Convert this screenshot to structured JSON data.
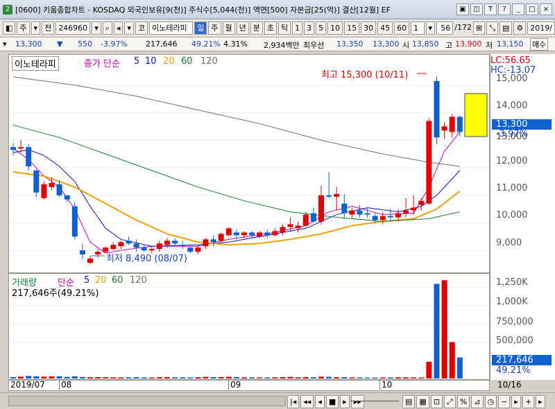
{
  "window": {
    "app_icon": "2",
    "title": "[0600] 키움종합차트 - KOSDAQ 외국인보유[9(천)] 주식수[5,044(천)] 액면[500] 자본금[25(억)] 결산[12월] EF",
    "controls": [
      "▣",
      "◫",
      "T",
      "?",
      "_",
      "□",
      "×"
    ]
  },
  "toolbar": {
    "market": "주",
    "prefix": "전",
    "code": "246960",
    "kind": "코",
    "name": "이노테라피",
    "periods": [
      "일",
      "주",
      "월",
      "년",
      "분",
      "초",
      "틱"
    ],
    "active_period": "일",
    "intervals": [
      "1",
      "3",
      "5",
      "10",
      "15",
      "30",
      "45",
      "60"
    ],
    "interval_value": "1",
    "count": "56",
    "total": "/172",
    "date": "2019/"
  },
  "quote": {
    "price": "13,300",
    "change": "550",
    "change_pct": "-3.97%",
    "volume": "217,646",
    "volume_ratio": "49.21%",
    "turnover": "4.31%",
    "amount": "2,934백만",
    "label_best": "최우선",
    "best_ask": "13,350",
    "best_bid": "13,300",
    "open_label": "시",
    "open": "13,850",
    "high_label": "고",
    "high": "13,900",
    "low_label": "저",
    "low": "13,150",
    "order_btn": "매수"
  },
  "legend": {
    "name": "이노테라피",
    "ma_label": "종가 단순",
    "ma_periods": [
      "5",
      "10",
      "20",
      "60",
      "120"
    ],
    "ma_colors": [
      "#c000c0",
      "#1010c0",
      "#f0a000",
      "#108030",
      "#707070"
    ]
  },
  "volume_legend": {
    "name": "거래량",
    "ma_label": "단순",
    "ma_periods": [
      "5",
      "20",
      "60",
      "120"
    ],
    "current": "217,646주(49.21%)"
  },
  "annotations": {
    "high": "최고 15,300 (10/11)",
    "low": "최저 8,490 (08/07)"
  },
  "axis": {
    "lc": "LC:56.65",
    "hc": "HC:-13.07",
    "price_ticks": [
      "15,000",
      "14,000",
      "13,000",
      "12,000",
      "11,000",
      "10,000",
      "9,000"
    ],
    "current_price": "13,300",
    "current_pct": "-3.97%",
    "vol_ticks": [
      "1,250K",
      "1,000K",
      "750,000",
      "500,000"
    ],
    "current_vol": "217,646",
    "current_vol_pct": "49.21%",
    "last_date": "10/16"
  },
  "dates": [
    "2019/07",
    "08",
    "09",
    "10"
  ],
  "colors": {
    "up": "#e00000",
    "down": "#1060d0",
    "accent": "#3366cc"
  },
  "chart_data": {
    "type": "candlestick",
    "price_range": [
      8300,
      15600
    ],
    "candles": [
      {
        "o": 12750,
        "h": 12900,
        "l": 12450,
        "c": 12650
      },
      {
        "o": 12700,
        "h": 13000,
        "l": 12550,
        "c": 12750
      },
      {
        "o": 12750,
        "h": 12850,
        "l": 11900,
        "c": 12050
      },
      {
        "o": 11900,
        "h": 11950,
        "l": 10950,
        "c": 11100
      },
      {
        "o": 10900,
        "h": 11500,
        "l": 10850,
        "c": 11400
      },
      {
        "o": 11300,
        "h": 11650,
        "l": 11200,
        "c": 11450
      },
      {
        "o": 11400,
        "h": 11550,
        "l": 10950,
        "c": 11000
      },
      {
        "o": 11000,
        "h": 11000,
        "l": 10750,
        "c": 10850
      },
      {
        "o": 10600,
        "h": 10750,
        "l": 9400,
        "c": 9500
      },
      {
        "o": 9000,
        "h": 9250,
        "l": 8700,
        "c": 8850
      },
      {
        "o": 8550,
        "h": 8800,
        "l": 8490,
        "c": 8700
      },
      {
        "o": 8850,
        "h": 9050,
        "l": 8750,
        "c": 8950
      },
      {
        "o": 8950,
        "h": 9150,
        "l": 8900,
        "c": 9100
      },
      {
        "o": 9050,
        "h": 9300,
        "l": 9000,
        "c": 9200
      },
      {
        "o": 9150,
        "h": 9350,
        "l": 9050,
        "c": 9300
      },
      {
        "o": 9350,
        "h": 9500,
        "l": 9200,
        "c": 9250
      },
      {
        "o": 9250,
        "h": 9400,
        "l": 8950,
        "c": 9100
      },
      {
        "o": 9100,
        "h": 9200,
        "l": 8950,
        "c": 9000
      },
      {
        "o": 9000,
        "h": 9150,
        "l": 8900,
        "c": 9050
      },
      {
        "o": 9050,
        "h": 9350,
        "l": 8950,
        "c": 9250
      },
      {
        "o": 9200,
        "h": 9450,
        "l": 9100,
        "c": 9350
      },
      {
        "o": 9350,
        "h": 9450,
        "l": 9150,
        "c": 9250
      },
      {
        "o": 9200,
        "h": 9350,
        "l": 9050,
        "c": 9150
      },
      {
        "o": 9100,
        "h": 9150,
        "l": 8900,
        "c": 8950
      },
      {
        "o": 8950,
        "h": 9200,
        "l": 8850,
        "c": 9100
      },
      {
        "o": 9150,
        "h": 9450,
        "l": 9050,
        "c": 9400
      },
      {
        "o": 9400,
        "h": 9550,
        "l": 9150,
        "c": 9300
      },
      {
        "o": 9350,
        "h": 9650,
        "l": 9300,
        "c": 9600
      },
      {
        "o": 9550,
        "h": 9850,
        "l": 9500,
        "c": 9800
      },
      {
        "o": 9650,
        "h": 9750,
        "l": 9400,
        "c": 9550
      },
      {
        "o": 9550,
        "h": 9700,
        "l": 9450,
        "c": 9650
      },
      {
        "o": 9650,
        "h": 9700,
        "l": 9450,
        "c": 9550
      },
      {
        "o": 9500,
        "h": 9700,
        "l": 9450,
        "c": 9650
      },
      {
        "o": 9650,
        "h": 9750,
        "l": 9450,
        "c": 9550
      },
      {
        "o": 9550,
        "h": 9800,
        "l": 9500,
        "c": 9700
      },
      {
        "o": 9650,
        "h": 9950,
        "l": 9550,
        "c": 9850
      },
      {
        "o": 9850,
        "h": 10200,
        "l": 9700,
        "c": 9950
      },
      {
        "o": 9800,
        "h": 10050,
        "l": 9650,
        "c": 9900
      },
      {
        "o": 9900,
        "h": 10400,
        "l": 9850,
        "c": 10300
      },
      {
        "o": 10350,
        "h": 10550,
        "l": 10000,
        "c": 10050
      },
      {
        "o": 10050,
        "h": 11350,
        "l": 9950,
        "c": 11000
      },
      {
        "o": 11000,
        "h": 11850,
        "l": 10900,
        "c": 10950
      },
      {
        "o": 10950,
        "h": 11300,
        "l": 10450,
        "c": 11050
      },
      {
        "o": 10700,
        "h": 11050,
        "l": 10150,
        "c": 10350
      },
      {
        "o": 10300,
        "h": 10550,
        "l": 10150,
        "c": 10450
      },
      {
        "o": 10450,
        "h": 10650,
        "l": 10200,
        "c": 10300
      },
      {
        "o": 10350,
        "h": 10550,
        "l": 10200,
        "c": 10300
      },
      {
        "o": 10250,
        "h": 10350,
        "l": 10000,
        "c": 10100
      },
      {
        "o": 10100,
        "h": 10400,
        "l": 9950,
        "c": 10250
      },
      {
        "o": 10250,
        "h": 10500,
        "l": 10050,
        "c": 10200
      },
      {
        "o": 10200,
        "h": 10500,
        "l": 10050,
        "c": 10350
      },
      {
        "o": 10350,
        "h": 10900,
        "l": 10200,
        "c": 10450
      },
      {
        "o": 10450,
        "h": 11000,
        "l": 10300,
        "c": 10550
      },
      {
        "o": 10650,
        "h": 10900,
        "l": 10450,
        "c": 10800
      },
      {
        "o": 10700,
        "h": 13800,
        "l": 10650,
        "c": 13700
      },
      {
        "o": 15150,
        "h": 15300,
        "l": 12850,
        "c": 13100
      },
      {
        "o": 13350,
        "h": 13650,
        "l": 13050,
        "c": 13500
      },
      {
        "o": 13300,
        "h": 13950,
        "l": 13100,
        "c": 13850
      },
      {
        "o": 13850,
        "h": 13900,
        "l": 13150,
        "c": 13300
      }
    ],
    "ma_lines": [
      {
        "period": 5,
        "values": [
          [
            0,
            12700
          ],
          [
            2,
            12300
          ],
          [
            4,
            11700
          ],
          [
            6,
            11300
          ],
          [
            8,
            10500
          ],
          [
            10,
            9300
          ],
          [
            12,
            8900
          ],
          [
            14,
            9000
          ],
          [
            18,
            9150
          ],
          [
            24,
            9150
          ],
          [
            28,
            9400
          ],
          [
            34,
            9650
          ],
          [
            38,
            9900
          ],
          [
            41,
            10400
          ],
          [
            44,
            10600
          ],
          [
            48,
            10300
          ],
          [
            52,
            10350
          ],
          [
            54,
            11300
          ],
          [
            56,
            12600
          ],
          [
            58,
            13300
          ]
        ]
      },
      {
        "period": 10,
        "values": [
          [
            0,
            12550
          ],
          [
            2,
            12650
          ],
          [
            4,
            12450
          ],
          [
            6,
            12050
          ],
          [
            8,
            11500
          ],
          [
            10,
            10600
          ],
          [
            12,
            9800
          ],
          [
            14,
            9400
          ],
          [
            18,
            9150
          ],
          [
            24,
            9200
          ],
          [
            28,
            9300
          ],
          [
            34,
            9600
          ],
          [
            38,
            9800
          ],
          [
            42,
            10300
          ],
          [
            46,
            10550
          ],
          [
            50,
            10400
          ],
          [
            53,
            10600
          ],
          [
            55,
            11000
          ],
          [
            58,
            11900
          ]
        ]
      },
      {
        "period": 20,
        "values": [
          [
            0,
            11850
          ],
          [
            4,
            11700
          ],
          [
            8,
            11300
          ],
          [
            12,
            10700
          ],
          [
            16,
            10100
          ],
          [
            20,
            9600
          ],
          [
            24,
            9300
          ],
          [
            28,
            9200
          ],
          [
            32,
            9250
          ],
          [
            36,
            9400
          ],
          [
            40,
            9600
          ],
          [
            44,
            9900
          ],
          [
            48,
            10050
          ],
          [
            52,
            10150
          ],
          [
            55,
            10500
          ],
          [
            58,
            11150
          ]
        ]
      },
      {
        "period": 60,
        "values": [
          [
            0,
            13550
          ],
          [
            6,
            13100
          ],
          [
            12,
            12500
          ],
          [
            18,
            11900
          ],
          [
            24,
            11300
          ],
          [
            30,
            10800
          ],
          [
            36,
            10400
          ],
          [
            42,
            10200
          ],
          [
            48,
            10050
          ],
          [
            54,
            10150
          ],
          [
            58,
            10400
          ]
        ]
      },
      {
        "period": 120,
        "values": [
          [
            0,
            15300
          ],
          [
            8,
            15000
          ],
          [
            16,
            14600
          ],
          [
            24,
            14100
          ],
          [
            32,
            13600
          ],
          [
            40,
            13000
          ],
          [
            48,
            12500
          ],
          [
            54,
            12200
          ],
          [
            58,
            12050
          ]
        ]
      }
    ],
    "volume_range": [
      0,
      1400000
    ],
    "volumes": [
      20000,
      25000,
      35000,
      30000,
      25000,
      28000,
      30000,
      22000,
      30000,
      20000,
      18000,
      19000,
      17000,
      16000,
      15000,
      16000,
      18000,
      15000,
      14000,
      18000,
      20000,
      17000,
      16000,
      14000,
      18000,
      22000,
      19000,
      20000,
      23000,
      19000,
      15000,
      16000,
      14000,
      15000,
      17000,
      20000,
      22000,
      16000,
      20000,
      18000,
      25000,
      23000,
      18000,
      19000,
      15000,
      14000,
      13000,
      13000,
      14000,
      15000,
      17000,
      16000,
      15000,
      14000,
      230000,
      1300000,
      1350000,
      500000,
      290000
    ]
  }
}
